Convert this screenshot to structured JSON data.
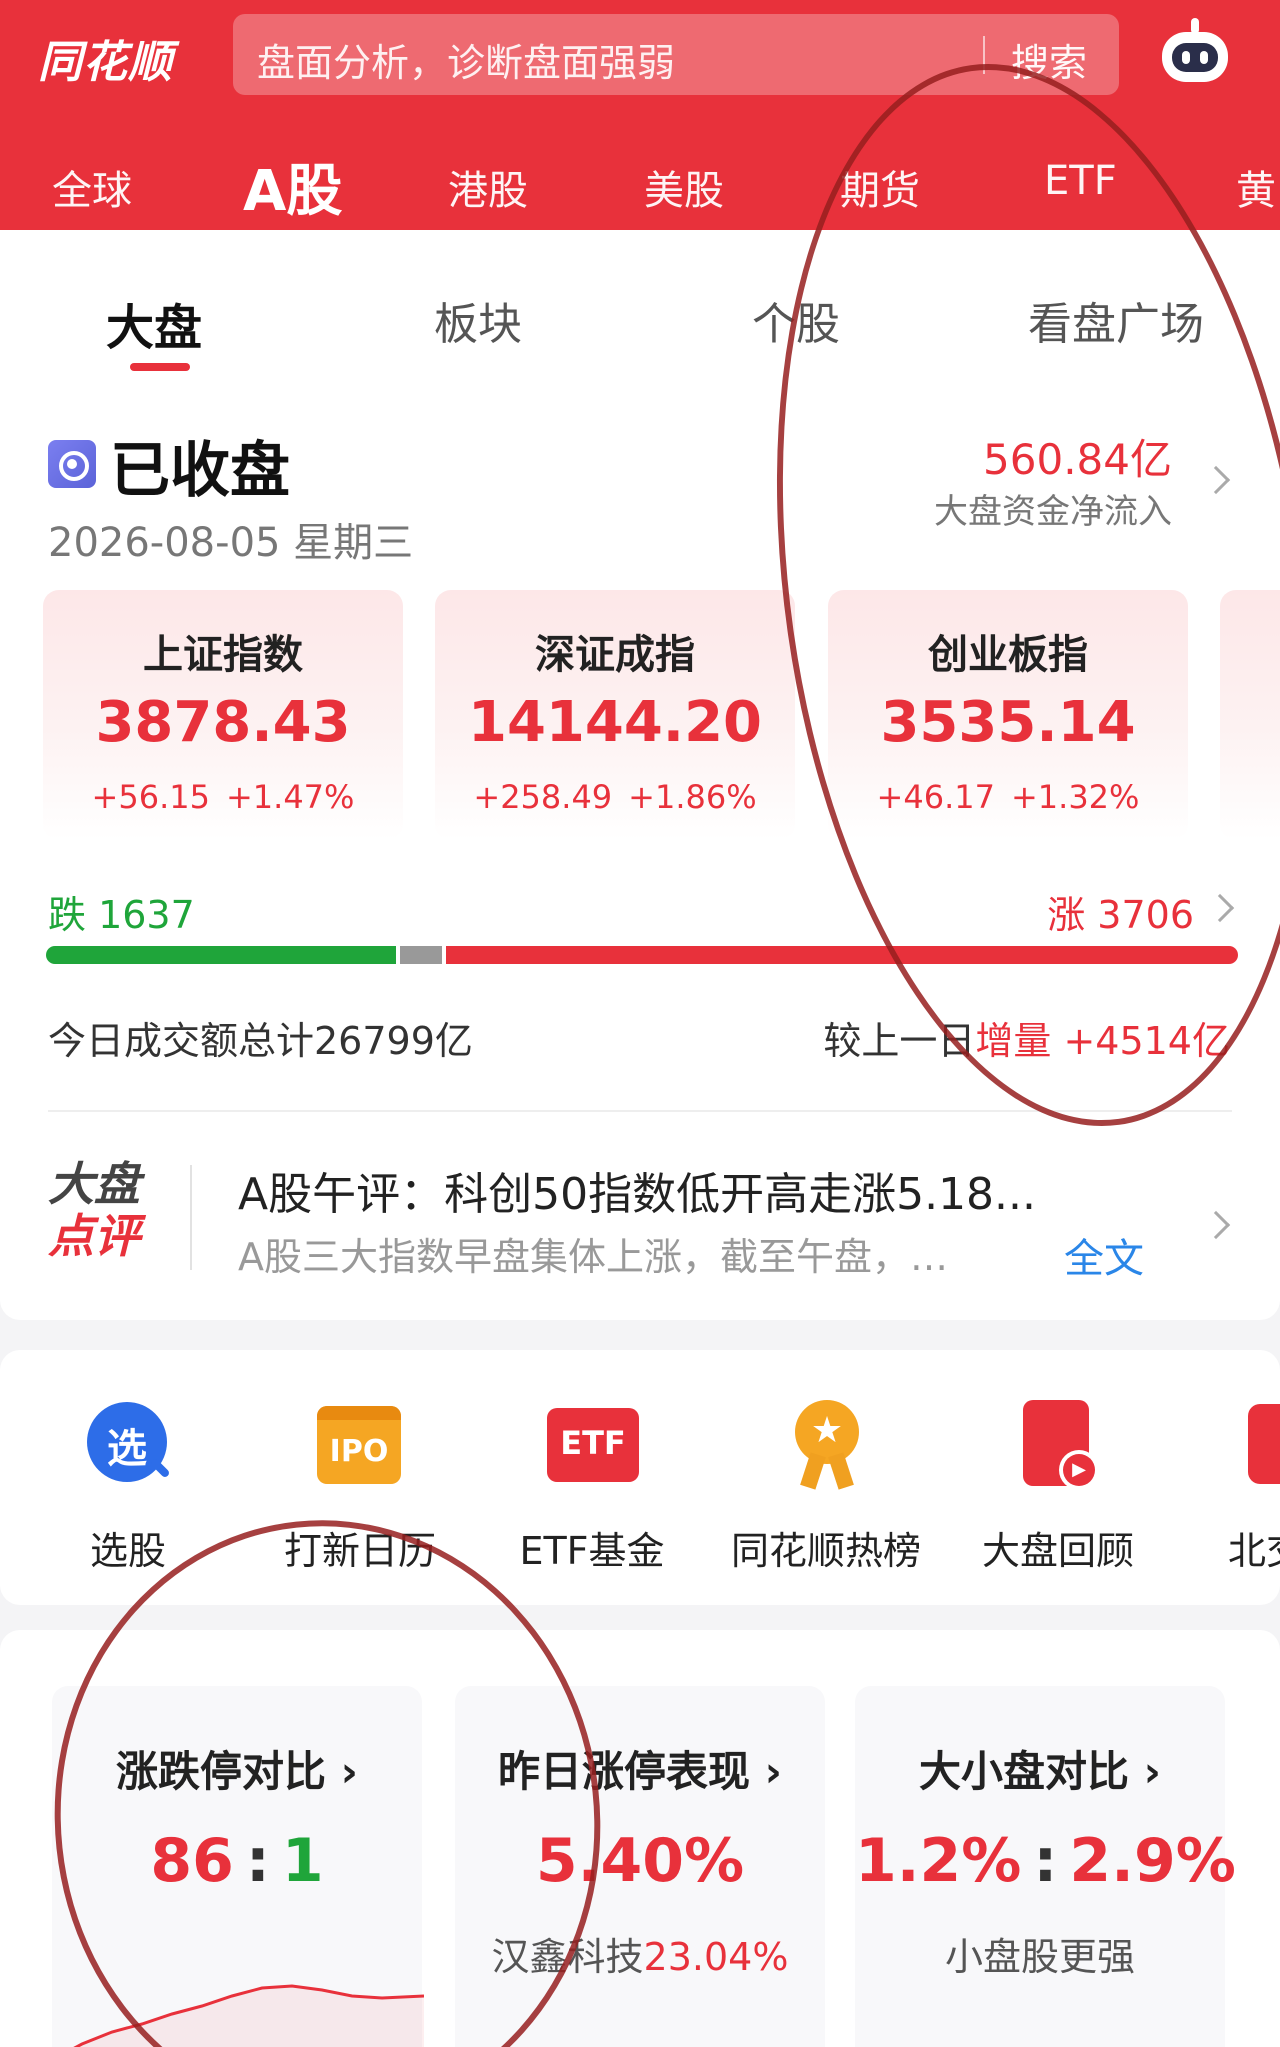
{
  "header": {
    "logo": "同花顺",
    "search_placeholder": "盘面分析，诊断盘面强弱",
    "search_button": "搜索",
    "assistant_icon": "robot-icon",
    "background": "#e8313b"
  },
  "market_tabs": [
    "全球",
    "A股",
    "港股",
    "美股",
    "期货",
    "ETF",
    "黄"
  ],
  "market_active": "A股",
  "sub_tabs": [
    "大盘",
    "板块",
    "个股",
    "看盘广场"
  ],
  "sub_active": "大盘",
  "market_status": {
    "status": "已收盘",
    "date": "2026-08-05 星期三",
    "net_inflow": "560.84亿",
    "net_inflow_label": "大盘资金净流入"
  },
  "indices": [
    {
      "name": "上证指数",
      "value": "3878.43",
      "change": "+56.15",
      "pct": "+1.47%"
    },
    {
      "name": "深证成指",
      "value": "14144.20",
      "change": "+258.49",
      "pct": "+1.86%"
    },
    {
      "name": "创业板指",
      "value": "3535.14",
      "change": "+46.17",
      "pct": "+1.32%"
    }
  ],
  "breadth": {
    "fall_label": "跌 1637",
    "rise_label": "涨 3706",
    "fall": 1637,
    "rise": 3706,
    "flat_fraction": 0.035
  },
  "turnover": {
    "total": "今日成交额总计26799亿",
    "compare_prefix": "较上一日",
    "compare_value": "增量 +4514亿"
  },
  "news": {
    "logo_line1": "大盘",
    "logo_line2": "点评",
    "title": "A股午评：科创50指数低开高走涨5.18...",
    "summary": "A股三大指数早盘集体上涨，截至午盘，…",
    "more": "全文"
  },
  "shortcuts": [
    {
      "label": "选股",
      "icon": "stock-picker-icon",
      "glyph": "选"
    },
    {
      "label": "打新日历",
      "icon": "ipo-calendar-icon",
      "glyph": "IPO"
    },
    {
      "label": "ETF基金",
      "icon": "etf-fund-icon",
      "glyph": "ETF"
    },
    {
      "label": "同花顺热榜",
      "icon": "hot-list-icon",
      "glyph": "★"
    },
    {
      "label": "大盘回顾",
      "icon": "market-review-icon",
      "glyph": "▶"
    },
    {
      "label": "北交",
      "icon": "bse-icon",
      "glyph": ""
    }
  ],
  "stats": [
    {
      "title": "涨跌停对比",
      "value_left": "86",
      "value_right": "1"
    },
    {
      "title": "昨日涨停表现",
      "value": "5.40%",
      "sub_name": "汉鑫科技",
      "sub_value": "23.04%"
    },
    {
      "title": "大小盘对比",
      "value_left": "1.2%",
      "value_right": "2.9%",
      "sub": "小盘股更强"
    }
  ],
  "colors": {
    "up": "#e8313b",
    "down": "#1fa53a",
    "link": "#2a86e8"
  }
}
